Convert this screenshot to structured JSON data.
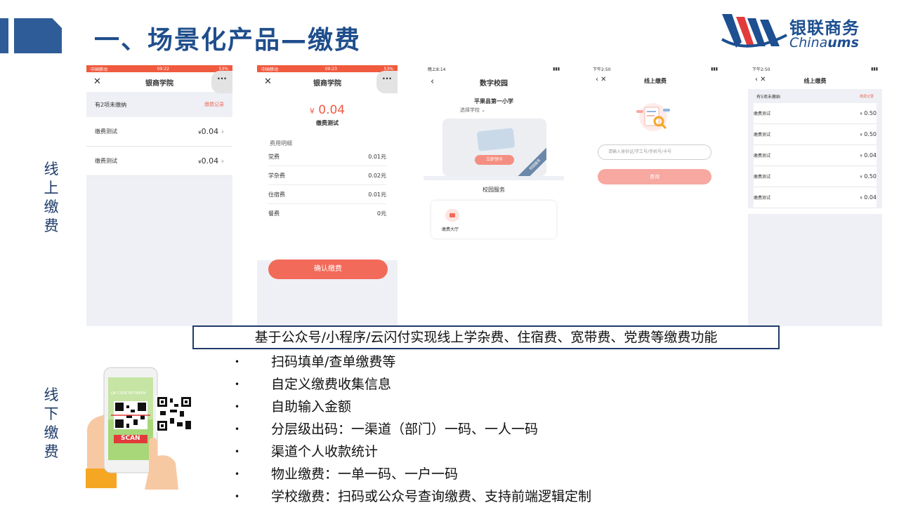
{
  "header": {
    "title": "一、场景化产品—缴费",
    "logo_cn": "银联商务",
    "logo_en_a": "China",
    "logo_en_b": "ums"
  },
  "labels": {
    "online": [
      "线",
      "上",
      "缴",
      "费"
    ],
    "offline": [
      "线",
      "下",
      "缴",
      "费"
    ]
  },
  "phone1": {
    "status_carrier": "中国移动",
    "status_time": "09:22",
    "status_battery": "53%",
    "close": "✕",
    "title": "银商学院",
    "more": "···",
    "notice": "有2项未缴纳",
    "record_link": "缴费记录",
    "items": [
      {
        "name": "缴费测试",
        "currency": "¥",
        "amount": "0.04",
        "arrow": "›"
      },
      {
        "name": "缴费测试",
        "currency": "¥",
        "amount": "0.04",
        "arrow": "›"
      }
    ]
  },
  "phone2": {
    "status_carrier": "中国移动",
    "status_time": "09:23",
    "status_battery": "53%",
    "close": "✕",
    "title": "银商学院",
    "more": "···",
    "currency": "¥",
    "amount": "0.04",
    "subtitle": "缴费测试",
    "detail_header": "费用明细",
    "details": [
      {
        "name": "党费",
        "value": "0.01元"
      },
      {
        "name": "学杂费",
        "value": "0.02元"
      },
      {
        "name": "住宿费",
        "value": "0.01元"
      },
      {
        "name": "餐费",
        "value": "0元"
      }
    ],
    "confirm_button": "确认缴费"
  },
  "phone3": {
    "status_time": "晚上8:14",
    "back": "‹",
    "title": "数字校园",
    "school": "平果县第一小学",
    "select_school": "选择学校",
    "card_button": "立即领卡",
    "ribbon": "校园服务",
    "service_header": "校园服务",
    "service_tile": "缴费大厅"
  },
  "phone4": {
    "status_time": "下午2:50",
    "nav": "‹ ✕",
    "title": "线上缴费",
    "input_placeholder": "请输入身份证/学工号/手机号/卡号",
    "query_button": "查询"
  },
  "phone5": {
    "status_time": "下午2:50",
    "nav": "‹ ✕",
    "title": "线上缴费",
    "notice": "有5项未缴纳",
    "record_link": "缴费记录",
    "items": [
      {
        "name": "缴费测试",
        "currency": "¥",
        "amount": "0.50"
      },
      {
        "name": "缴费测试",
        "currency": "¥",
        "amount": "0.50"
      },
      {
        "name": "缴费测试",
        "currency": "¥",
        "amount": "0.04"
      },
      {
        "name": "缴费测试",
        "currency": "¥",
        "amount": "0.50"
      },
      {
        "name": "缴费测试",
        "currency": "¥",
        "amount": "0.04"
      }
    ]
  },
  "banner": "基于公众号/小程序/云闪付实现线上学杂费、住宿费、宽带费、党费等缴费功能",
  "bullet_symbol": "•",
  "bullets": [
    "扫码填单/查单缴费等",
    "自定义缴费收集信息",
    "自助输入金额",
    "分层级出码：一渠道（部门）一码、一人一码",
    "渠道个人收款统计",
    "物业缴费：一单一码、一户一码",
    "学校缴费：扫码或公众号查询缴费、支持前端逻辑定制"
  ],
  "scan": {
    "screen_text": "QR CODE BETWEEN",
    "scan_label": "SCAN"
  },
  "colors": {
    "brand_blue": "#1f4e8c",
    "accent_red": "#f26a5a"
  }
}
